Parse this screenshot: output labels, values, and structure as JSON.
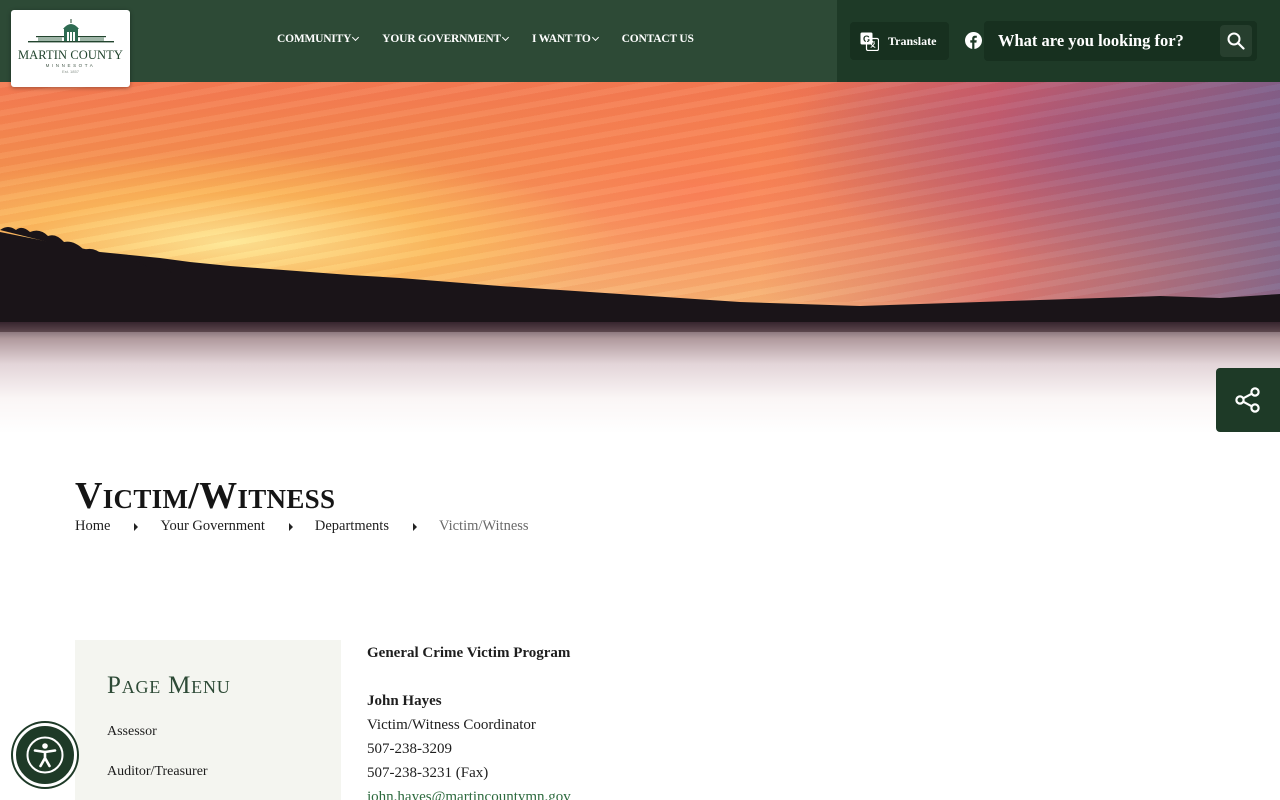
{
  "logo": {
    "name": "MARTIN COUNTY",
    "state": "MINNESOTA",
    "est": "Est. 1857"
  },
  "nav": {
    "items": [
      {
        "label": "COMMUNITY"
      },
      {
        "label": "YOUR GOVERNMENT"
      },
      {
        "label": "I WANT TO"
      },
      {
        "label": "CONTACT US"
      }
    ]
  },
  "header": {
    "translate_label": "Translate",
    "search_placeholder": "What are you looking for?"
  },
  "page": {
    "title": "Victim/Witness",
    "breadcrumb": [
      "Home",
      "Your Government",
      "Departments",
      "Victim/Witness"
    ]
  },
  "page_menu": {
    "title": "Page Menu",
    "items": [
      "Assessor",
      "Auditor/Treasurer"
    ]
  },
  "content": {
    "program": "General Crime Victim Program",
    "contact": {
      "name": "John Hayes",
      "role": "Victim/Witness Coordinator",
      "phone": "507-238-3209",
      "fax": "507-238-3231 (Fax)",
      "email": "john.hayes@martincountymn.gov"
    }
  },
  "colors": {
    "header_bg": "#2d4a36",
    "header_dark": "#1e3a27",
    "menu_bg": "#f4f5f0"
  },
  "icons": [
    "google-translate-icon",
    "facebook-icon",
    "search-icon",
    "share-icon",
    "accessibility-icon"
  ]
}
